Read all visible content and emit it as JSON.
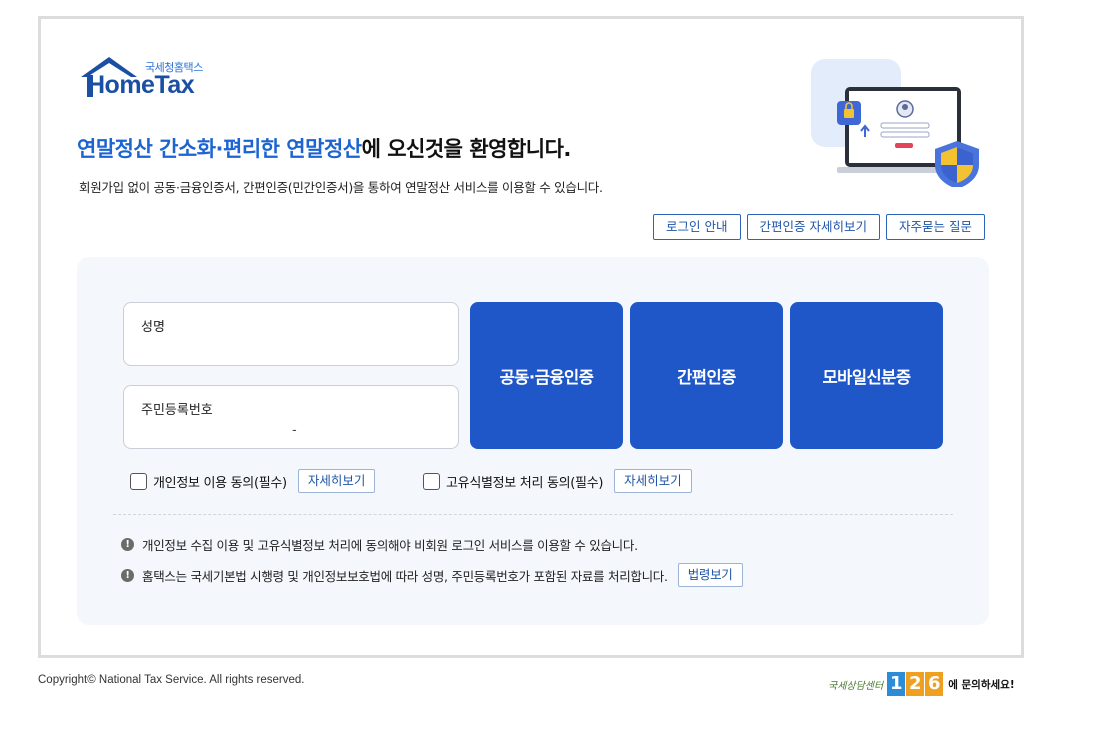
{
  "logo": {
    "small_text": "국세청홈택스",
    "brand": "HomeTax"
  },
  "headline": {
    "blue1": "연말정산 간소화·편리한 연말정산",
    "rest": "에 오신것을 환영합니다."
  },
  "subtext": "회원가입 없이 공동·금융인증서, 간편인증(민간인증서)을 통하여 연말정산 서비스를 이용할 수 있습니다.",
  "top_links": [
    "로그인 안내",
    "간편인증 자세히보기",
    "자주묻는 질문"
  ],
  "form": {
    "name_label": "성명",
    "name_value": "",
    "rrn_label": "주민등록번호",
    "rrn_separator": "-"
  },
  "auth_buttons": [
    "공동·금융인증",
    "간편인증",
    "모바일신분증"
  ],
  "agreements": [
    {
      "label": "개인정보 이용 동의(필수)",
      "detail": "자세히보기",
      "checked": false
    },
    {
      "label": "고유식별정보 처리 동의(필수)",
      "detail": "자세히보기",
      "checked": false
    }
  ],
  "notices": [
    {
      "text": "개인정보 수집 이용 및 고유식별정보 처리에 동의해야 비회원 로그인 서비스를 이용할 수 있습니다."
    },
    {
      "text": "홈택스는 국세기본법 시행령 및 개인정보보호법에 따라 성명, 주민등록번호가 포함된 자료를 처리합니다.",
      "button": "법령보기"
    }
  ],
  "footer": {
    "copyright": "Copyright© National Tax Service. All rights reserved.",
    "call_center_label": "국세상담센터",
    "call_center_number": [
      "1",
      "2",
      "6"
    ],
    "call_center_suffix": "에 문의하세요!"
  },
  "colors": {
    "brand_blue": "#2057c8",
    "headline_blue": "#1c64d1",
    "panel_bg": "#f4f7fc"
  },
  "icons": [
    "house-logo-icon",
    "laptop-shield-illustration",
    "exclamation-icon",
    "checkbox-icon"
  ]
}
